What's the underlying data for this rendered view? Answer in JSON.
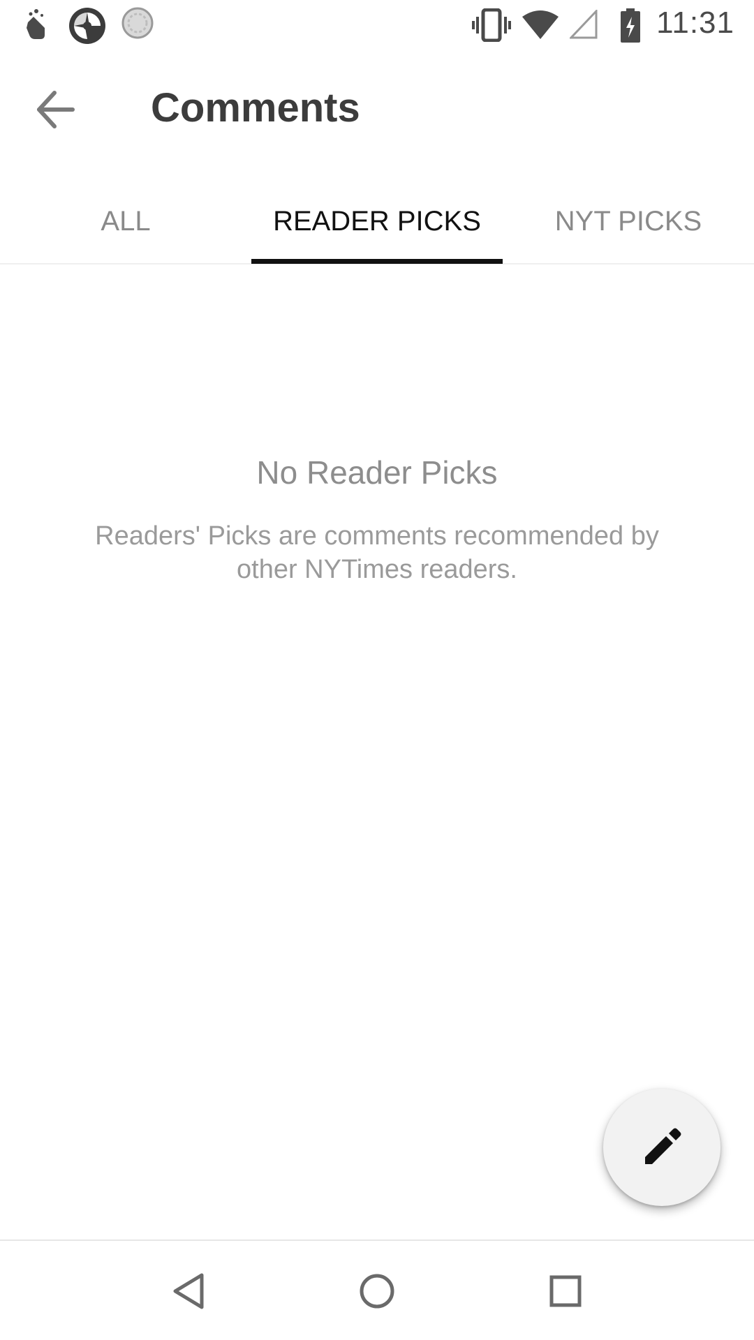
{
  "status_bar": {
    "time": "11:31",
    "left_icons": [
      "gesture-hand-icon",
      "app-shutter-icon",
      "sync-circle-icon"
    ],
    "right_icons": [
      "vibrate-icon",
      "wifi-icon",
      "signal-icon",
      "battery-charging-icon"
    ]
  },
  "app_bar": {
    "title": "Comments",
    "back_icon": "arrow-back-icon"
  },
  "tabs": [
    {
      "label": "ALL",
      "active": false
    },
    {
      "label": "READER PICKS",
      "active": true
    },
    {
      "label": "NYT PICKS",
      "active": false
    }
  ],
  "empty_state": {
    "title": "No Reader Picks",
    "description": "Readers' Picks are comments recommended by other NYTimes readers."
  },
  "fab": {
    "icon": "pencil-icon"
  },
  "nav_bar": {
    "icons": [
      "back-triangle-icon",
      "home-circle-icon",
      "recents-square-icon"
    ]
  },
  "colors": {
    "tab_active": "#111111",
    "tab_inactive": "#8a8a8a",
    "title": "#3c3c3c",
    "empty_text": "#8d8d8d"
  }
}
